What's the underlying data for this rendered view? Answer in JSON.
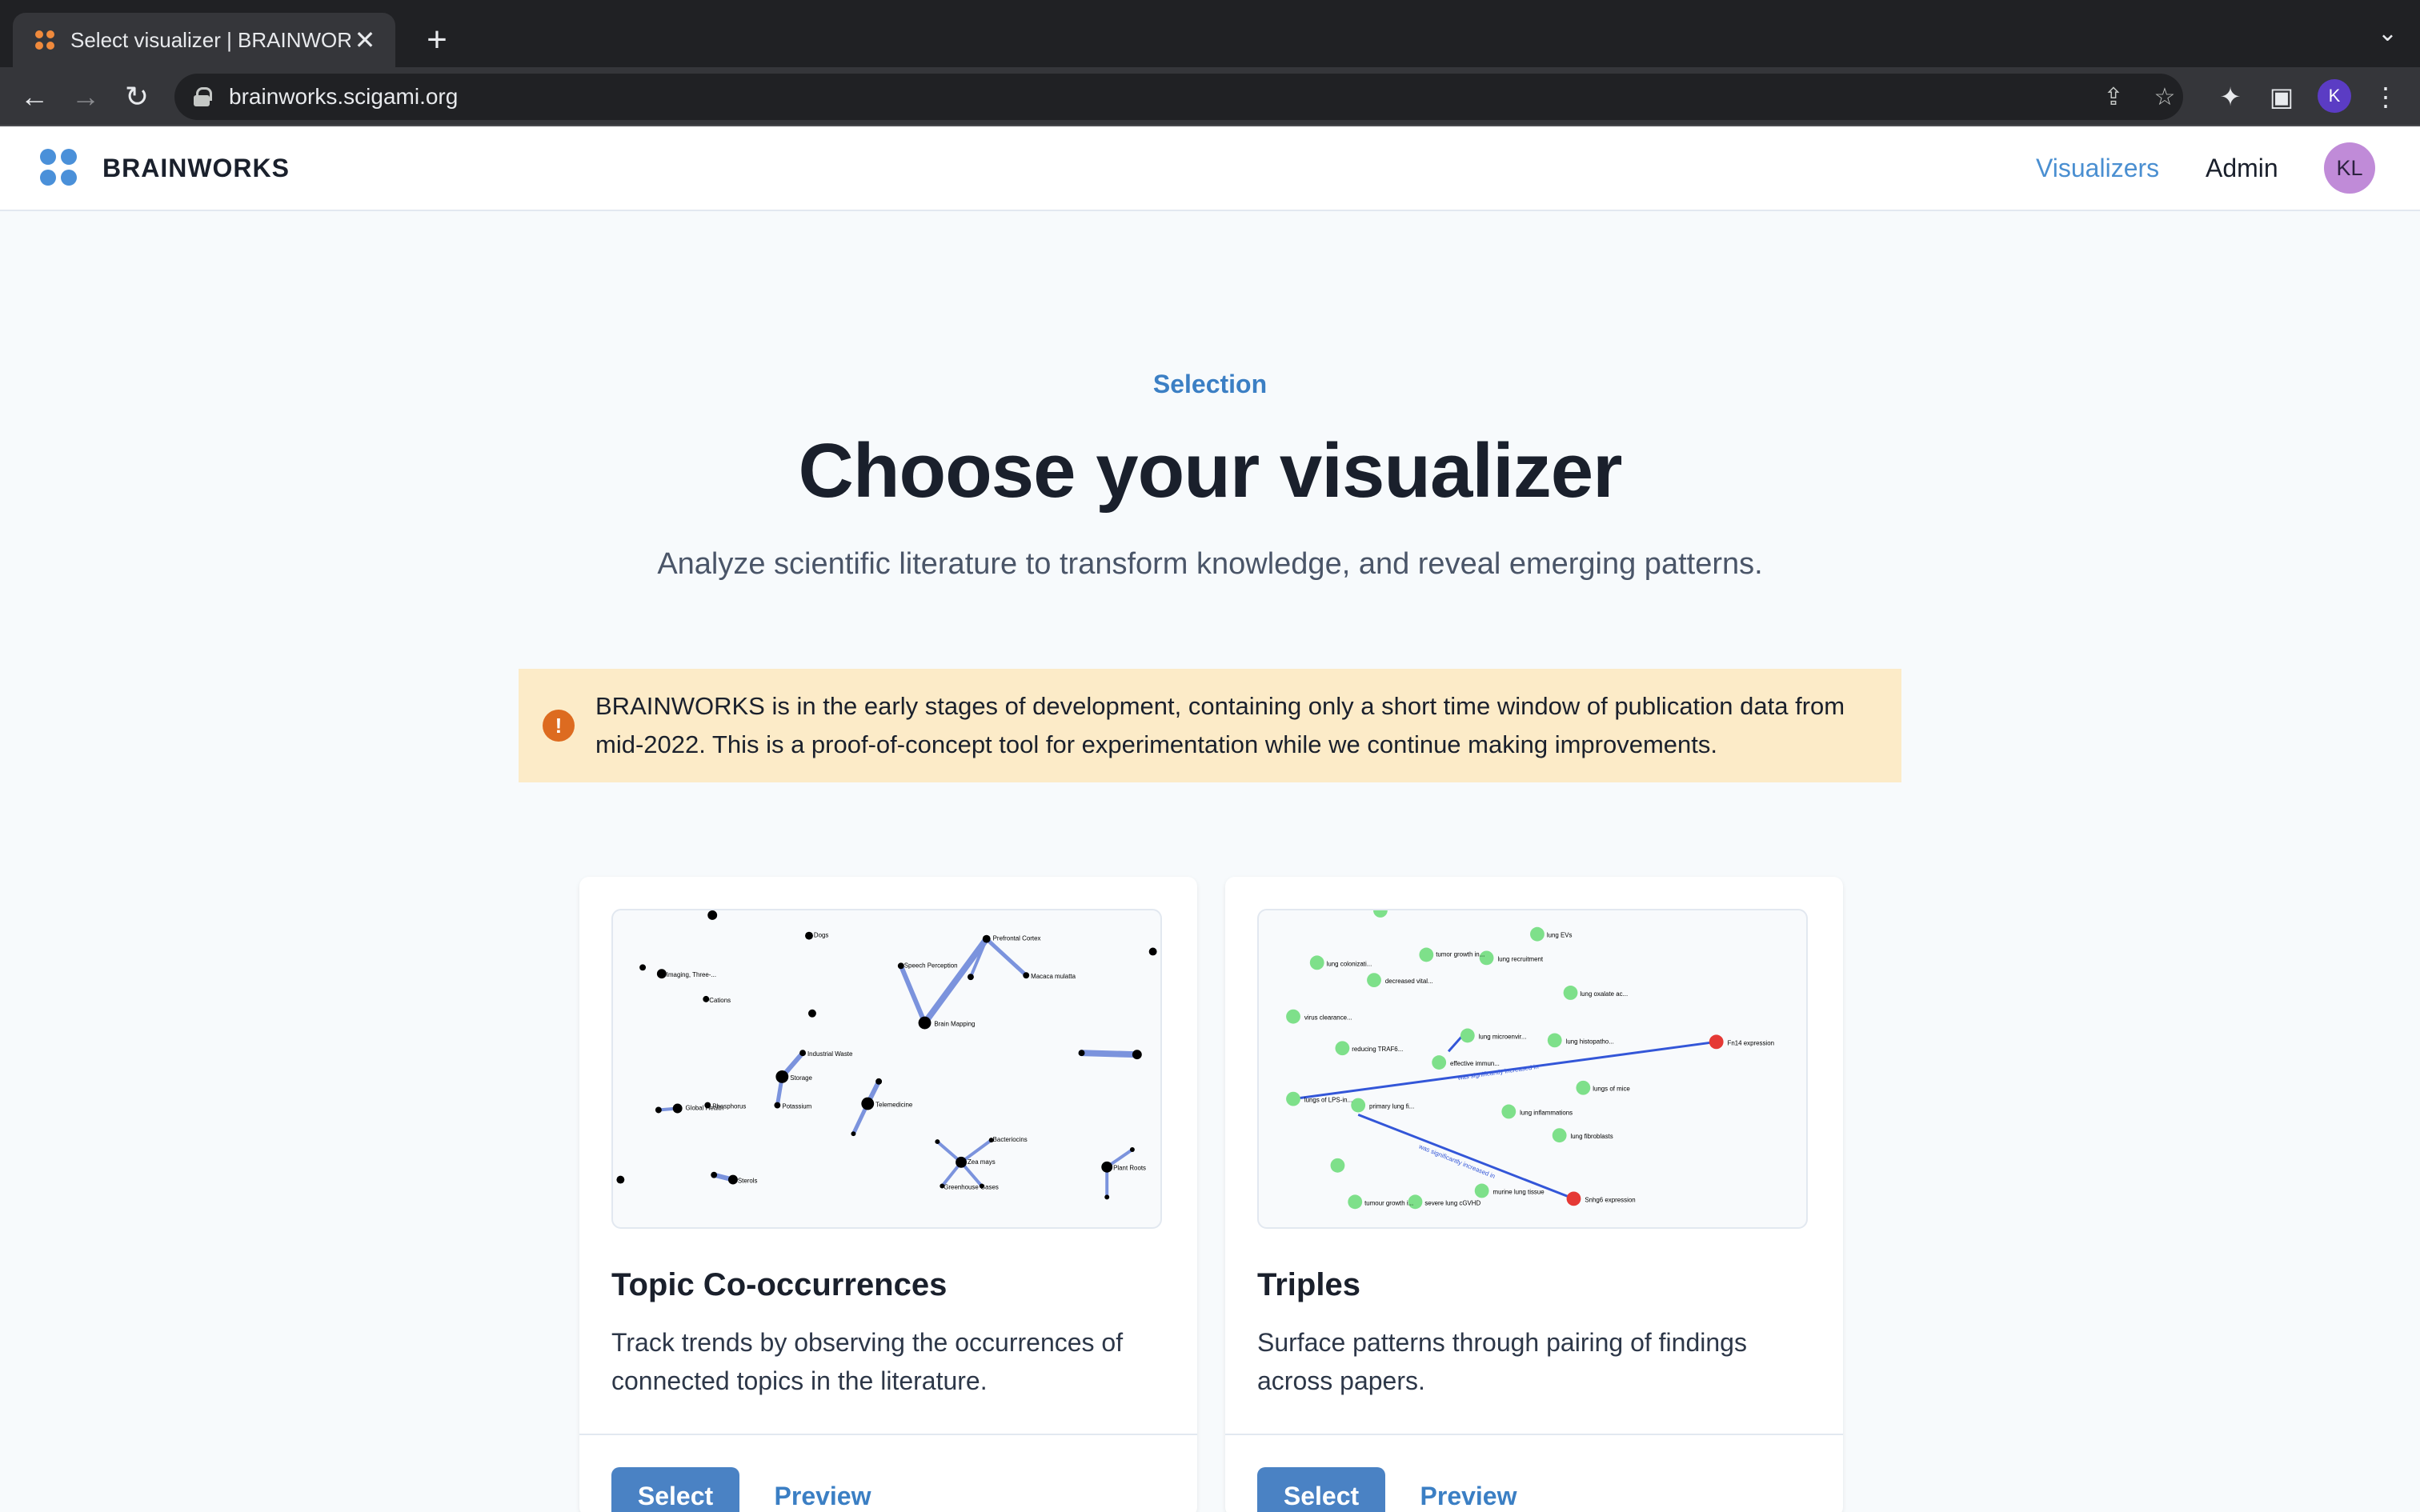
{
  "browser": {
    "tab_title": "Select visualizer | BRAINWORKS",
    "tab_close": "✕",
    "new_tab": "+",
    "tab_menu": "⌄",
    "url": "brainworks.scigami.org",
    "back": "←",
    "forward": "→",
    "reload": "↻",
    "share": "⇪",
    "star": "☆",
    "extensions": "✦",
    "sidepanel": "▣",
    "menu": "⋮",
    "profile_initial": "K"
  },
  "header": {
    "brand": "BRAINWORKS",
    "nav": {
      "visualizers": "Visualizers",
      "admin": "Admin"
    },
    "avatar_initials": "KL",
    "colors": {
      "active_nav": "#4a8fd1",
      "logo": "#4a90d9"
    }
  },
  "hero": {
    "eyebrow": "Selection",
    "title": "Choose your visualizer",
    "subtitle": "Analyze scientific literature to transform knowledge, and reveal emerging patterns."
  },
  "alert": {
    "icon": "!",
    "text": "BRAINWORKS is in the early stages of development, containing only a short time window of publication data from mid-2022. This is a proof-of-concept tool for experimentation while we continue making improvements.",
    "color": "#fcebc8"
  },
  "cards": [
    {
      "title": "Topic Co-occurrences",
      "description": "Track trends by observing the occurrences of connected topics in the literature.",
      "select_label": "Select",
      "preview_label": "Preview",
      "thumb_labels": [
        "Brain Mapping",
        "Prefrontal Cortex",
        "Speech Perception",
        "Macaca mulatta",
        "Global Health",
        "Industrial Waste",
        "Storage",
        "Potassium",
        "Telemedicine",
        "Phosphorus",
        "Zea mays",
        "Greenhouse Gases",
        "Bacteriocins",
        "Plant Roots",
        "Imaging, Three-...",
        "Cations",
        "Dogs",
        "Sterols"
      ]
    },
    {
      "title": "Triples",
      "description": "Surface patterns through pairing of findings across papers.",
      "select_label": "Select",
      "preview_label": "Preview",
      "thumb_labels": [
        "lung EVs",
        "tumor growth in...",
        "lung recruitment",
        "lung colonizati...",
        "decreased vital...",
        "lung oxalate ac...",
        "virus clearance...",
        "lung microenvir...",
        "lung histopatho...",
        "Fn14 expression",
        "reducing TRAF6...",
        "effective immun...",
        "lungs of mice",
        "lungs of LPS-in...",
        "primary lung fi...",
        "lung inflammations",
        "lung fibroblasts",
        "tumour growth i...",
        "severe lung cGVHD",
        "murine lung tissue",
        "Snhg6 expression",
        "was significantly increased in"
      ]
    }
  ]
}
